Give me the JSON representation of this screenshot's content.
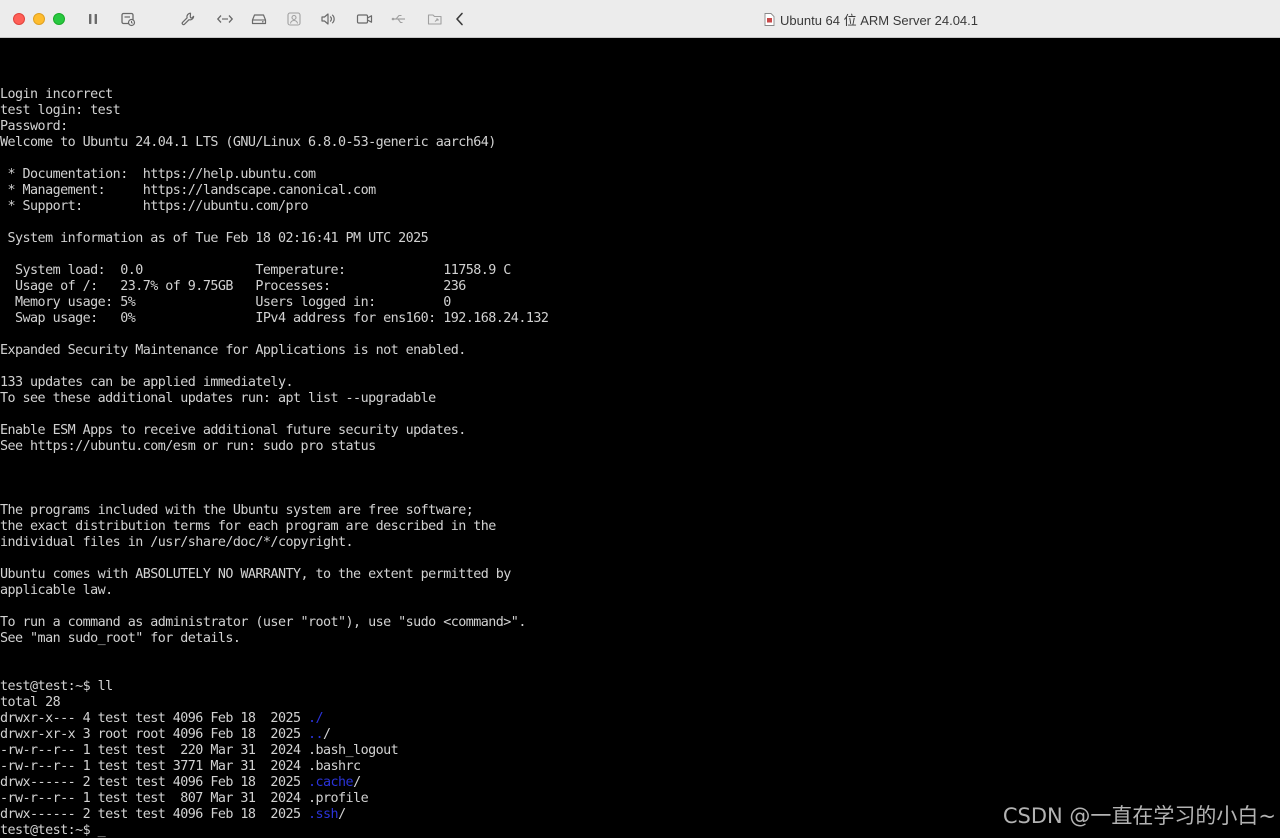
{
  "window": {
    "title": "Ubuntu 64 位 ARM Server 24.04.1",
    "toolbar_icons": [
      "pause-icon",
      "snapshot-icon",
      "wrench-icon",
      "code-icon",
      "hard-disk-icon",
      "user-icon",
      "speaker-icon",
      "camera-icon",
      "usb-icon",
      "shared-folder-icon",
      "chevron-left-icon"
    ]
  },
  "terminal": {
    "lines": [
      {
        "text": "Login incorrect"
      },
      {
        "text": "test login: test"
      },
      {
        "text": "Password:"
      },
      {
        "text": "Welcome to Ubuntu 24.04.1 LTS (GNU/Linux 6.8.0-53-generic aarch64)"
      },
      {
        "text": ""
      },
      {
        "text": " * Documentation:  https://help.ubuntu.com"
      },
      {
        "text": " * Management:     https://landscape.canonical.com"
      },
      {
        "text": " * Support:        https://ubuntu.com/pro"
      },
      {
        "text": ""
      },
      {
        "text": " System information as of Tue Feb 18 02:16:41 PM UTC 2025"
      },
      {
        "text": ""
      },
      {
        "text": "  System load:  0.0               Temperature:             11758.9 C"
      },
      {
        "text": "  Usage of /:   23.7% of 9.75GB   Processes:               236"
      },
      {
        "text": "  Memory usage: 5%                Users logged in:         0"
      },
      {
        "text": "  Swap usage:   0%                IPv4 address for ens160: 192.168.24.132"
      },
      {
        "text": ""
      },
      {
        "text": "Expanded Security Maintenance for Applications is not enabled."
      },
      {
        "text": ""
      },
      {
        "text": "133 updates can be applied immediately."
      },
      {
        "text": "To see these additional updates run: apt list --upgradable"
      },
      {
        "text": ""
      },
      {
        "text": "Enable ESM Apps to receive additional future security updates."
      },
      {
        "text": "See https://ubuntu.com/esm or run: sudo pro status"
      },
      {
        "text": ""
      },
      {
        "text": ""
      },
      {
        "text": ""
      },
      {
        "text": "The programs included with the Ubuntu system are free software;"
      },
      {
        "text": "the exact distribution terms for each program are described in the"
      },
      {
        "text": "individual files in /usr/share/doc/*/copyright."
      },
      {
        "text": ""
      },
      {
        "text": "Ubuntu comes with ABSOLUTELY NO WARRANTY, to the extent permitted by"
      },
      {
        "text": "applicable law."
      },
      {
        "text": ""
      },
      {
        "text": "To run a command as administrator (user \"root\"), use \"sudo <command>\"."
      },
      {
        "text": "See \"man sudo_root\" for details."
      },
      {
        "text": ""
      },
      {
        "text": ""
      },
      {
        "text": "test@test:~$ ll"
      },
      {
        "text": "total 28"
      },
      {
        "text": "drwxr-x--- 4 test test 4096 Feb 18  2025 ",
        "dir": "./",
        "suffix": ""
      },
      {
        "text": "drwxr-xr-x 3 root root 4096 Feb 18  2025 ",
        "dir": "..",
        "suffix": "/"
      },
      {
        "text": "-rw-r--r-- 1 test test  220 Mar 31  2024 .bash_logout"
      },
      {
        "text": "-rw-r--r-- 1 test test 3771 Mar 31  2024 .bashrc"
      },
      {
        "text": "drwx------ 2 test test 4096 Feb 18  2025 ",
        "dir": ".cache",
        "suffix": "/"
      },
      {
        "text": "-rw-r--r-- 1 test test  807 Mar 31  2024 .profile"
      },
      {
        "text": "drwx------ 2 test test 4096 Feb 18  2025 ",
        "dir": ".ssh",
        "suffix": "/"
      },
      {
        "text": "test@test:~$ ",
        "cursor": "_"
      }
    ]
  },
  "watermark": "CSDN @一直在学习的小白~",
  "colors": {
    "terminal_bg": "#000000",
    "terminal_fg": "#d2d2d2",
    "directory": "#2a33d8",
    "titlebar_bg": "#ececec"
  }
}
